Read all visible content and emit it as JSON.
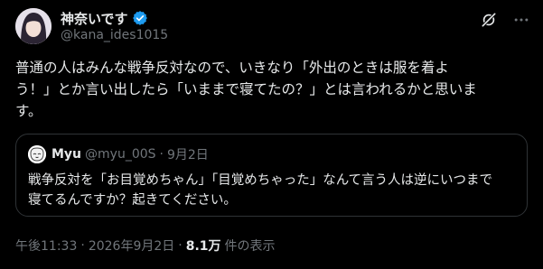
{
  "author": {
    "display_name": "神奈いです",
    "handle": "@kana_ides1015"
  },
  "tweet": {
    "text_lines": [
      "普通の人はみんな戦争反対なので、いきなり「外出のときは服を着よ",
      "う！」とか言い出したら「いままで寝てたの？」とは言われるかと思いま",
      "す。"
    ]
  },
  "quote": {
    "display_name": "Myu",
    "handle": "@myu_00S",
    "separator": "·",
    "date": "9月2日",
    "text_lines": [
      "戦争反対を「お目覚めちゃん」「目覚めちゃった」なんて言う人は逆にいつまで",
      "寝てるんですか？起きてください。"
    ]
  },
  "meta": {
    "time": "午後11:33",
    "separator": "·",
    "date": "2026年9月2日",
    "views_count": "8.1万",
    "views_label": "件の表示"
  },
  "icons": {
    "verified": "verified-badge-icon",
    "grok": "grok-icon",
    "more": "more-options-icon"
  },
  "colors": {
    "background": "#000000",
    "text": "#e7e9ea",
    "secondary": "#71767b",
    "verified": "#1d9bf0",
    "border": "#2f3336"
  }
}
